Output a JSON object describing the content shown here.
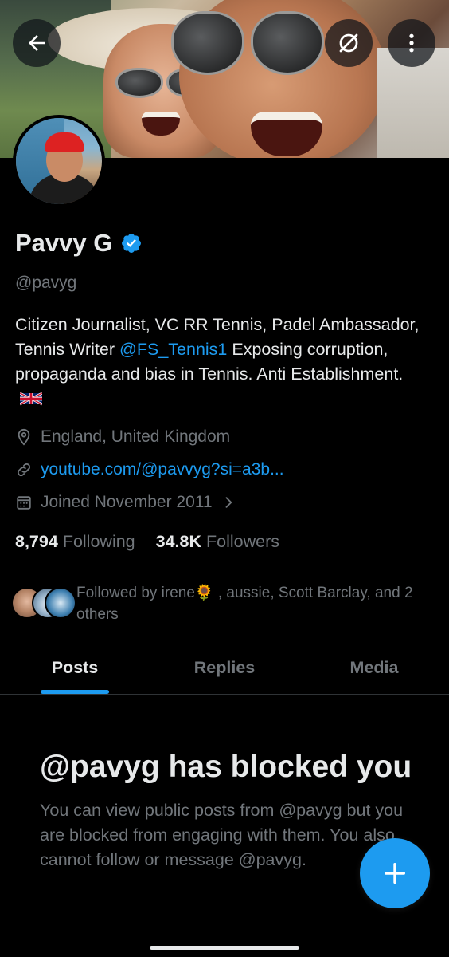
{
  "profile": {
    "name": "Pavvy G",
    "handle": "@pavyg",
    "verified": true,
    "bio_line1": "Citizen Journalist, VC RR Tennis, Padel Ambassador, Tennis Writer ",
    "bio_mention": "@FS_Tennis1",
    "bio_line2": " Exposing corruption, propaganda and bias in Tennis. Anti Establishment.",
    "bio_flag_icon": "uk-flag-icon",
    "location": "England, United Kingdom",
    "website": "youtube.com/@pavvyg?si=a3b...",
    "joined": "Joined November 2011"
  },
  "stats": {
    "following_count": "8,794",
    "following_label": "Following",
    "followers_count": "34.8K",
    "followers_label": "Followers"
  },
  "followed_by": {
    "text": "Followed by irene🌻 , aussie, Scott Barclay, and 2 others"
  },
  "tabs": [
    {
      "label": "Posts",
      "active": true
    },
    {
      "label": "Replies",
      "active": false
    },
    {
      "label": "Media",
      "active": false
    }
  ],
  "blocked": {
    "title": "@pavyg has blocked you",
    "body": "You can view public posts from @pavyg but you are blocked from engaging with them. You also cannot follow or message @pavyg."
  },
  "icons": {
    "back": "arrow-left-icon",
    "unsubscribe": "slashed-circle-icon",
    "more": "more-vertical-icon",
    "verified": "verified-badge-icon",
    "location": "location-pin-icon",
    "link": "link-icon",
    "calendar": "calendar-icon",
    "chevron": "chevron-right-icon",
    "compose": "plus-icon"
  },
  "colors": {
    "accent": "#1d9bf0",
    "background": "#000000",
    "text_primary": "#e7e9ea",
    "text_secondary": "#71767b"
  }
}
